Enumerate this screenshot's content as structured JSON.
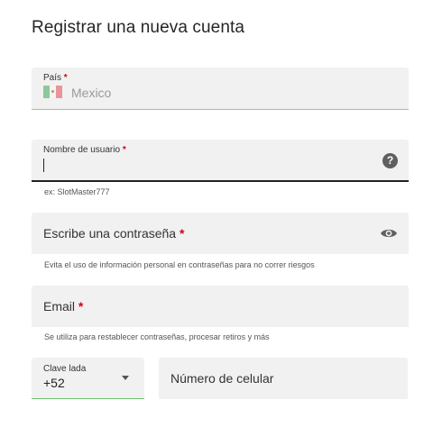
{
  "header": {
    "title": "Registrar una nueva cuenta"
  },
  "country": {
    "label": "País",
    "required_mark": "*",
    "value": "Mexico"
  },
  "username": {
    "label": "Nombre de usuario",
    "required_mark": "*",
    "value": "",
    "helper": "ex: SlotMaster777",
    "help_icon": "question-circle-icon"
  },
  "password": {
    "label": "Escribe una contraseña",
    "required_mark": "*",
    "helper": "Evita el uso de información personal en contraseñas para no correr riesgos",
    "toggle_icon": "eye-icon"
  },
  "email": {
    "label": "Email",
    "required_mark": "*",
    "helper": "Se utiliza para restablecer contraseñas, procesar retiros y más"
  },
  "phone": {
    "prefix_label": "Clave lada",
    "prefix_value": "+52",
    "dropdown_icon": "caret-down-icon",
    "number_label": "Número de celular"
  },
  "colors": {
    "accent_green": "#6fbf6f",
    "required_red": "#d0021b",
    "field_bg": "#f1f1f1"
  }
}
